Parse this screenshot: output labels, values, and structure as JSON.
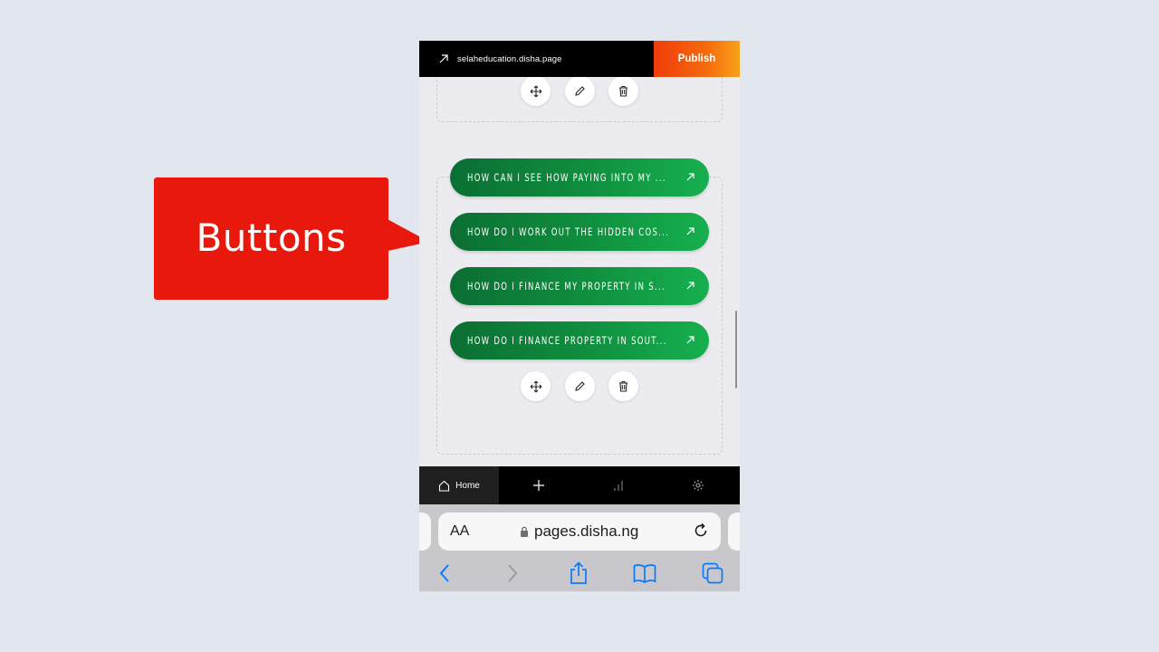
{
  "callout": {
    "label": "Buttons",
    "color": "#e8190c"
  },
  "editor": {
    "site_url": "selaheducation.disha.page",
    "publish_label": "Publish",
    "link_buttons": [
      {
        "label": "HOW CAN I SEE HOW PAYING INTO MY ..."
      },
      {
        "label": "HOW DO I WORK OUT THE HIDDEN COS..."
      },
      {
        "label": "HOW DO I FINANCE MY PROPERTY IN S..."
      },
      {
        "label": "HOW DO I FINANCE PROPERTY IN SOUT..."
      }
    ],
    "tool_icons": [
      "move-icon",
      "edit-icon",
      "trash-icon"
    ],
    "bottom_nav": {
      "home_label": "Home",
      "items": [
        "home-icon",
        "add-icon",
        "analytics-icon",
        "settings-icon"
      ]
    }
  },
  "browser": {
    "text_size_label": "AA",
    "domain": "pages.disha.ng",
    "toolbar_icons": [
      "back-icon",
      "forward-icon",
      "share-icon",
      "bookmarks-icon",
      "tabs-icon"
    ]
  },
  "colors": {
    "button_green_start": "#0b6e33",
    "button_green_end": "#16b04f",
    "publish_orange": "#f56a0c",
    "safari_blue": "#0a7aff"
  }
}
